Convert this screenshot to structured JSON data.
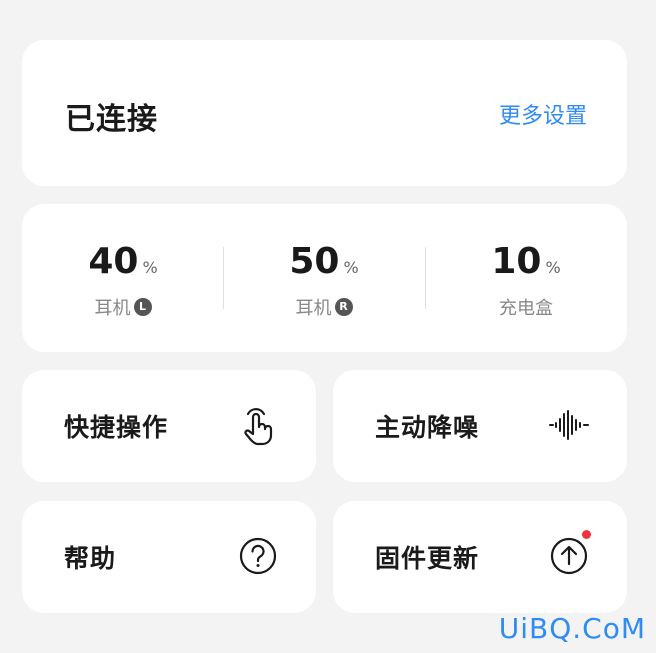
{
  "connection": {
    "status": "已连接",
    "more_settings": "更多设置"
  },
  "battery": [
    {
      "value": "40",
      "unit": "%",
      "label": "耳机",
      "side": "L"
    },
    {
      "value": "50",
      "unit": "%",
      "label": "耳机",
      "side": "R"
    },
    {
      "value": "10",
      "unit": "%",
      "label": "充电盒",
      "side": ""
    }
  ],
  "tiles": {
    "quick_actions": {
      "label": "快捷操作",
      "icon": "touch-gesture-icon"
    },
    "noise_cancel": {
      "label": "主动降噪",
      "icon": "sound-wave-icon"
    },
    "help": {
      "label": "帮助",
      "icon": "question-circle-icon"
    },
    "firmware": {
      "label": "固件更新",
      "icon": "upload-arrow-circle-icon",
      "has_update_dot": true
    }
  },
  "watermark": "UiBQ.CoM",
  "colors": {
    "accent": "#2f8bf5",
    "update_dot": "#f0323c",
    "background": "#f3f3f3",
    "card": "#ffffff"
  }
}
